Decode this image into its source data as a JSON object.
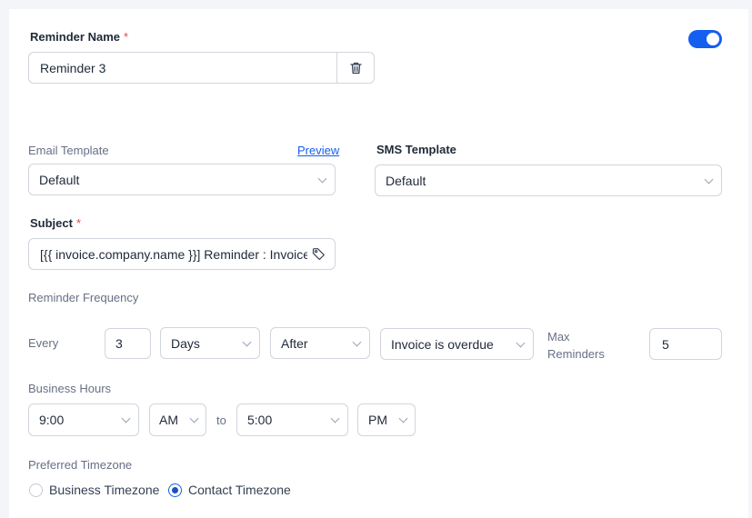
{
  "reminder": {
    "name_label": "Reminder Name",
    "required_mark": "*",
    "name_value": "Reminder 3",
    "enabled": true
  },
  "email": {
    "label": "Email Template",
    "preview_link": "Preview",
    "selected": "Default"
  },
  "sms": {
    "label": "SMS Template",
    "selected": "Default"
  },
  "subject": {
    "label": "Subject",
    "required_mark": "*",
    "value": "[{{ invoice.company.name }}] Reminder : Invoice Due"
  },
  "frequency": {
    "label": "Reminder Frequency",
    "every_label": "Every",
    "count": "3",
    "unit": "Days",
    "relation": "After",
    "trigger": "Invoice is overdue",
    "max_label_line1": "Max",
    "max_label_line2": "Reminders",
    "max_value": "5"
  },
  "business_hours": {
    "label": "Business Hours",
    "start_time": "9:00",
    "start_period": "AM",
    "to_label": "to",
    "end_time": "5:00",
    "end_period": "PM"
  },
  "timezone": {
    "label": "Preferred Timezone",
    "options": [
      {
        "label": "Business Timezone",
        "selected": false
      },
      {
        "label": "Contact Timezone",
        "selected": true
      }
    ]
  },
  "icons": {
    "delete": "trash-icon",
    "tag": "tag-icon",
    "dropdown": "chevron-down-icon"
  },
  "colors": {
    "accent": "#155eef",
    "required": "#e5484d",
    "border": "#d0d5dd",
    "muted_text": "#667085"
  }
}
